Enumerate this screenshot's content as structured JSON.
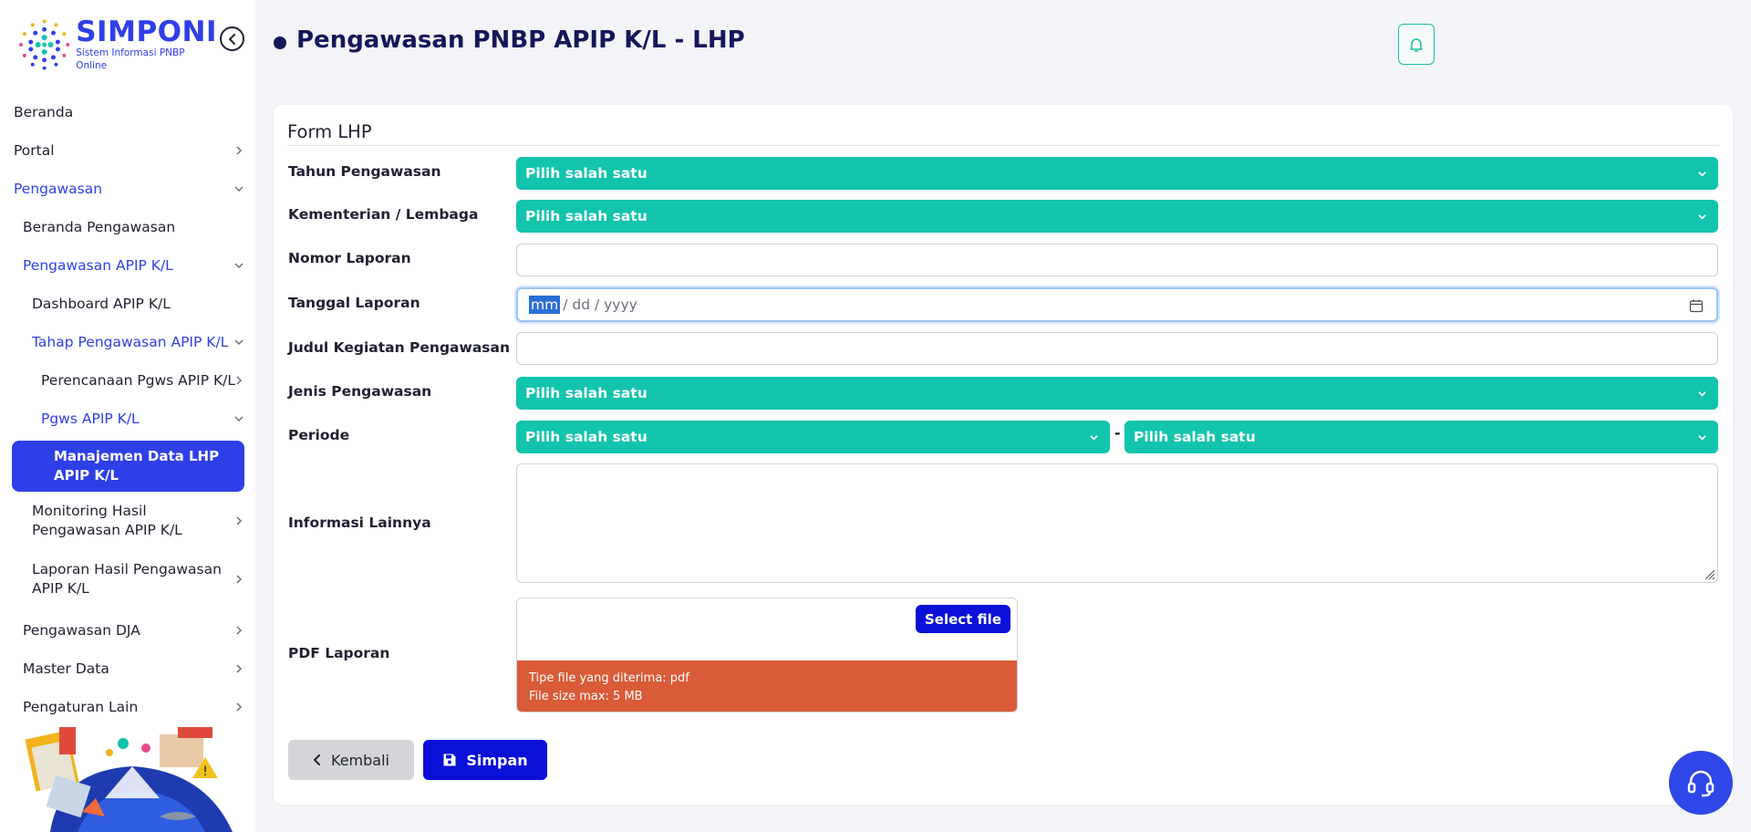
{
  "brand": {
    "name": "SIMPONI",
    "subtitle": "Sistem Informasi PNBP Online"
  },
  "sidebar": {
    "items": [
      {
        "label": "Beranda"
      },
      {
        "label": "Portal"
      },
      {
        "label": "Pengawasan"
      },
      {
        "label": "Beranda Pengawasan"
      },
      {
        "label": "Pengawasan APIP K/L"
      },
      {
        "label": "Dashboard APIP K/L"
      },
      {
        "label": "Tahap Pengawasan APIP K/L"
      },
      {
        "label": "Perencanaan Pgws APIP K/L"
      },
      {
        "label": "Pgws APIP K/L"
      },
      {
        "label": "Manajemen Data LHP APIP K/L"
      },
      {
        "label": "Monitoring Hasil Pengawasan APIP K/L"
      },
      {
        "label": "Laporan Hasil Pengawasan APIP K/L"
      },
      {
        "label": "Pengawasan DJA"
      },
      {
        "label": "Master Data"
      },
      {
        "label": "Pengaturan Lain"
      }
    ]
  },
  "header": {
    "title": "Pengawasan PNBP APIP K/L - LHP"
  },
  "form": {
    "title": "Form LHP",
    "tahun": {
      "label": "Tahun Pengawasan",
      "value": "Pilih salah satu"
    },
    "kementerian": {
      "label": "Kementerian / Lembaga",
      "value": "Pilih salah satu"
    },
    "nomor": {
      "label": "Nomor Laporan",
      "value": ""
    },
    "tanggal": {
      "label": "Tanggal Laporan",
      "mm": "mm",
      "rest": "/ dd / yyyy"
    },
    "judul": {
      "label": "Judul Kegiatan Pengawasan",
      "value": ""
    },
    "jenis": {
      "label": "Jenis Pengawasan",
      "value": "Pilih salah satu"
    },
    "periode": {
      "label": "Periode",
      "start": "Pilih salah satu",
      "separator": "-",
      "end": "Pilih salah satu"
    },
    "informasi": {
      "label": "Informasi Lainnya",
      "value": ""
    },
    "pdf": {
      "label": "PDF Laporan",
      "button": "Select file",
      "info_type": "Tipe file yang diterima: pdf",
      "info_size": "File size max: 5 MB"
    },
    "buttons": {
      "back": "Kembali",
      "save": "Simpan"
    }
  },
  "colors": {
    "primary": "#2f3fe8",
    "select": "#12c4ac",
    "save": "#0a10d8",
    "upload_info": "#d95b38"
  }
}
